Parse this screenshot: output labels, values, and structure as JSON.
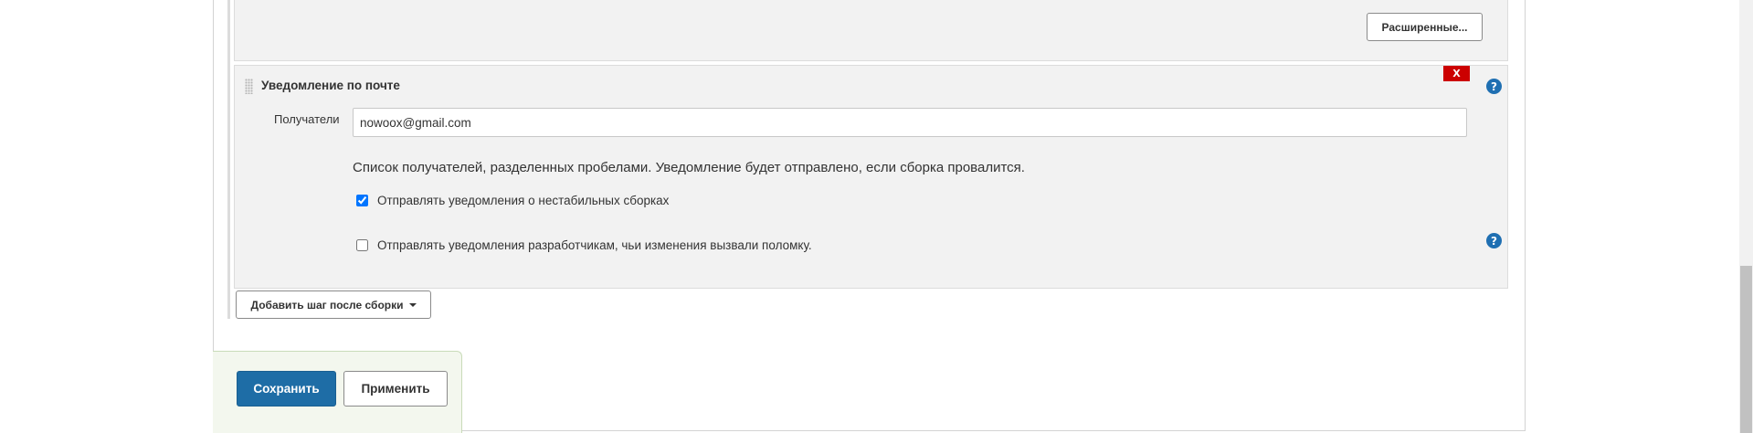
{
  "previous_section": {
    "advanced_button_label": "Расширенные..."
  },
  "email_notification": {
    "title": "Уведомление по почте",
    "delete_label": "X",
    "help_icon_glyph": "?",
    "recipients_label": "Получатели",
    "recipients_value": "nowoox@gmail.com",
    "recipients_help": "Список получателей, разделенных пробелами. Уведомление будет отправлено, если сборка провалится.",
    "options": [
      {
        "label": "Отправлять уведомления о нестабильных сборках",
        "checked": true
      },
      {
        "label": "Отправлять уведомления разработчикам, чьи изменения вызвали поломку.",
        "checked": false
      }
    ]
  },
  "add_post_build_step_label": "Добавить шаг после сборки",
  "footer": {
    "save_label": "Сохранить",
    "apply_label": "Применить"
  },
  "colors": {
    "primary_button": "#1e6da6",
    "delete_button": "#cc0000",
    "help_icon": "#1f6fb2",
    "section_background": "#f2f2f2",
    "footer_background": "#f3f7ee"
  },
  "icons": [
    "drag-handle-icon",
    "help-icon",
    "chevron-down-icon",
    "checkbox-checked-icon",
    "checkbox-unchecked-icon"
  ]
}
